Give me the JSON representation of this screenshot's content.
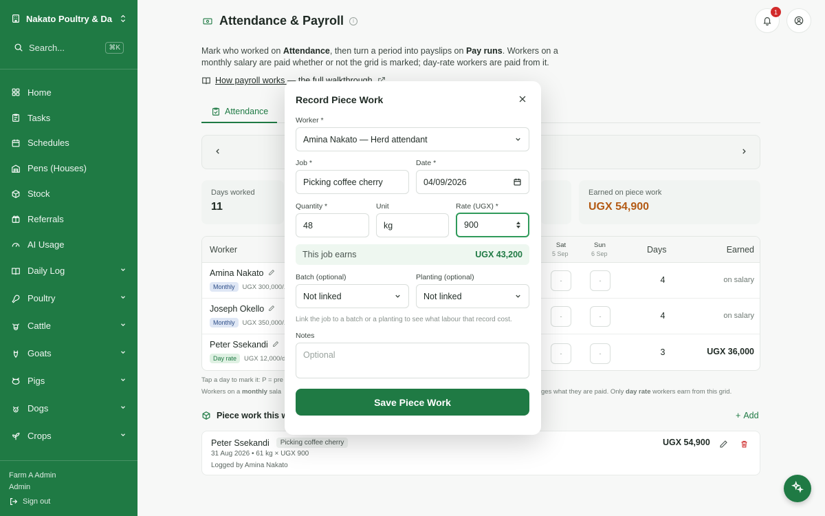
{
  "sidebar": {
    "farm_name": "Nakato Poultry & Da...",
    "search_placeholder": "Search...",
    "search_shortcut": "⌘K",
    "items": [
      {
        "label": "Home",
        "icon": "grid-icon"
      },
      {
        "label": "Tasks",
        "icon": "clipboard-icon"
      },
      {
        "label": "Schedules",
        "icon": "calendar-icon"
      },
      {
        "label": "Pens (Houses)",
        "icon": "warehouse-icon"
      },
      {
        "label": "Stock",
        "icon": "package-icon"
      },
      {
        "label": "Referrals",
        "icon": "gift-icon"
      },
      {
        "label": "AI Usage",
        "icon": "gauge-icon"
      }
    ],
    "groups": [
      {
        "label": "Daily Log",
        "icon": "book-icon"
      },
      {
        "label": "Poultry",
        "icon": "drumstick-icon"
      },
      {
        "label": "Cattle",
        "icon": "cattle-icon"
      },
      {
        "label": "Goats",
        "icon": "goat-icon"
      },
      {
        "label": "Pigs",
        "icon": "pig-icon"
      },
      {
        "label": "Dogs",
        "icon": "dog-icon"
      },
      {
        "label": "Crops",
        "icon": "sprout-icon"
      }
    ],
    "user_name": "Farm A Admin",
    "user_role": "Admin",
    "signout_label": "Sign out"
  },
  "header": {
    "title": "Attendance & Payroll",
    "notification_count": "1"
  },
  "intro": {
    "part1": "Mark who worked on ",
    "bold1": "Attendance",
    "part2": ", then turn a period into payslips on ",
    "bold2": "Pay runs",
    "part3": ". Workers on a monthly salary are paid whether or not the grid is marked; day-rate workers are paid from it.",
    "link": "How payroll works — the full walkthrough"
  },
  "tabs": {
    "attendance": "Attendance"
  },
  "stats": {
    "days_worked_label": "Days worked",
    "days_worked_value": "11",
    "piece_label": "Earned on piece work",
    "piece_value": "UGX 54,900"
  },
  "grid": {
    "col_worker": "Worker",
    "col_sat": "Sat",
    "col_sat_date": "5 Sep",
    "col_sun": "Sun",
    "col_sun_date": "6 Sep",
    "col_days": "Days",
    "col_earned": "Earned",
    "empty_cell": "-",
    "rows": [
      {
        "name": "Amina Nakato",
        "type": "Monthly",
        "pay": "UGX 300,000/...",
        "days": "4",
        "earned": "on salary"
      },
      {
        "name": "Joseph Okello",
        "type": "Monthly",
        "pay": "UGX 350,000/...",
        "days": "4",
        "earned": "on salary"
      },
      {
        "name": "Peter Ssekandi",
        "type": "Day rate",
        "pay": "UGX 12,000/d...",
        "days": "3",
        "earned": "UGX 36,000"
      }
    ],
    "note1": "Tap a day to mark it: P = pre",
    "note2_a": "Workers on a ",
    "note2_b": "monthly",
    "note2_c": " sala",
    "note2_d": "ges what they are paid. Only ",
    "note2_e": "day rate",
    "note2_f": " workers earn from this grid."
  },
  "piece_work": {
    "heading": "Piece work this we",
    "add_label": "Add",
    "entry": {
      "worker": "Peter Ssekandi",
      "job": "Picking coffee cherry",
      "detail": "31 Aug 2026 • 61 kg × UGX 900",
      "logged": "Logged by Amina Nakato",
      "amount": "UGX 54,900"
    }
  },
  "modal": {
    "title": "Record Piece Work",
    "worker_label": "Worker *",
    "worker_value": "Amina Nakato — Herd attendant",
    "job_label": "Job *",
    "job_value": "Picking coffee cherry",
    "date_label": "Date *",
    "date_value": "04/09/2026",
    "qty_label": "Quantity *",
    "qty_value": "48",
    "unit_label": "Unit",
    "unit_value": "kg",
    "rate_label": "Rate (UGX) *",
    "rate_value": "900",
    "earns_label": "This job earns",
    "earns_value": "UGX 43,200",
    "batch_label": "Batch (optional)",
    "batch_value": "Not linked",
    "planting_label": "Planting (optional)",
    "planting_value": "Not linked",
    "hint": "Link the job to a batch or a planting to see what labour that record cost.",
    "notes_label": "Notes",
    "notes_placeholder": "Optional",
    "save_label": "Save Piece Work"
  },
  "colors": {
    "brand": "#1f7a44",
    "accent_amount": "#b35a14",
    "danger": "#d23a3a"
  }
}
